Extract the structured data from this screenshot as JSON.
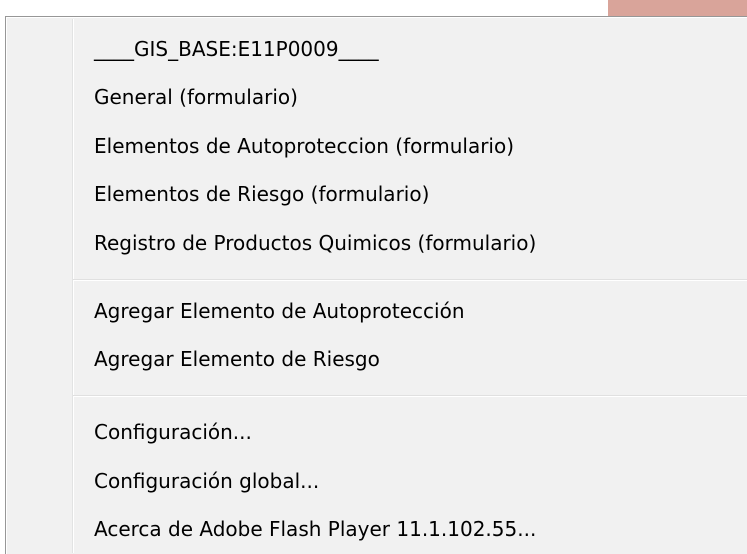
{
  "menu": {
    "groups": [
      {
        "items": [
          {
            "label": "____GIS_BASE:E11P0009____"
          },
          {
            "label": "General (formulario)"
          },
          {
            "label": "Elementos de Autoproteccion (formulario)"
          },
          {
            "label": "Elementos de Riesgo (formulario)"
          },
          {
            "label": "Registro de Productos Quimicos (formulario)"
          }
        ]
      },
      {
        "items": [
          {
            "label": "Agregar Elemento de Autoprotección"
          },
          {
            "label": "Agregar Elemento de Riesgo"
          }
        ]
      },
      {
        "items": [
          {
            "label": "Configuración..."
          },
          {
            "label": "Configuración global..."
          },
          {
            "label": "Acerca de Adobe Flash Player 11.1.102.55..."
          }
        ]
      }
    ]
  },
  "colors": {
    "menu_background": "#f1f1f1",
    "border": "#979797",
    "separator": "#e0e0e0",
    "background_accent": "#d9a49a"
  }
}
